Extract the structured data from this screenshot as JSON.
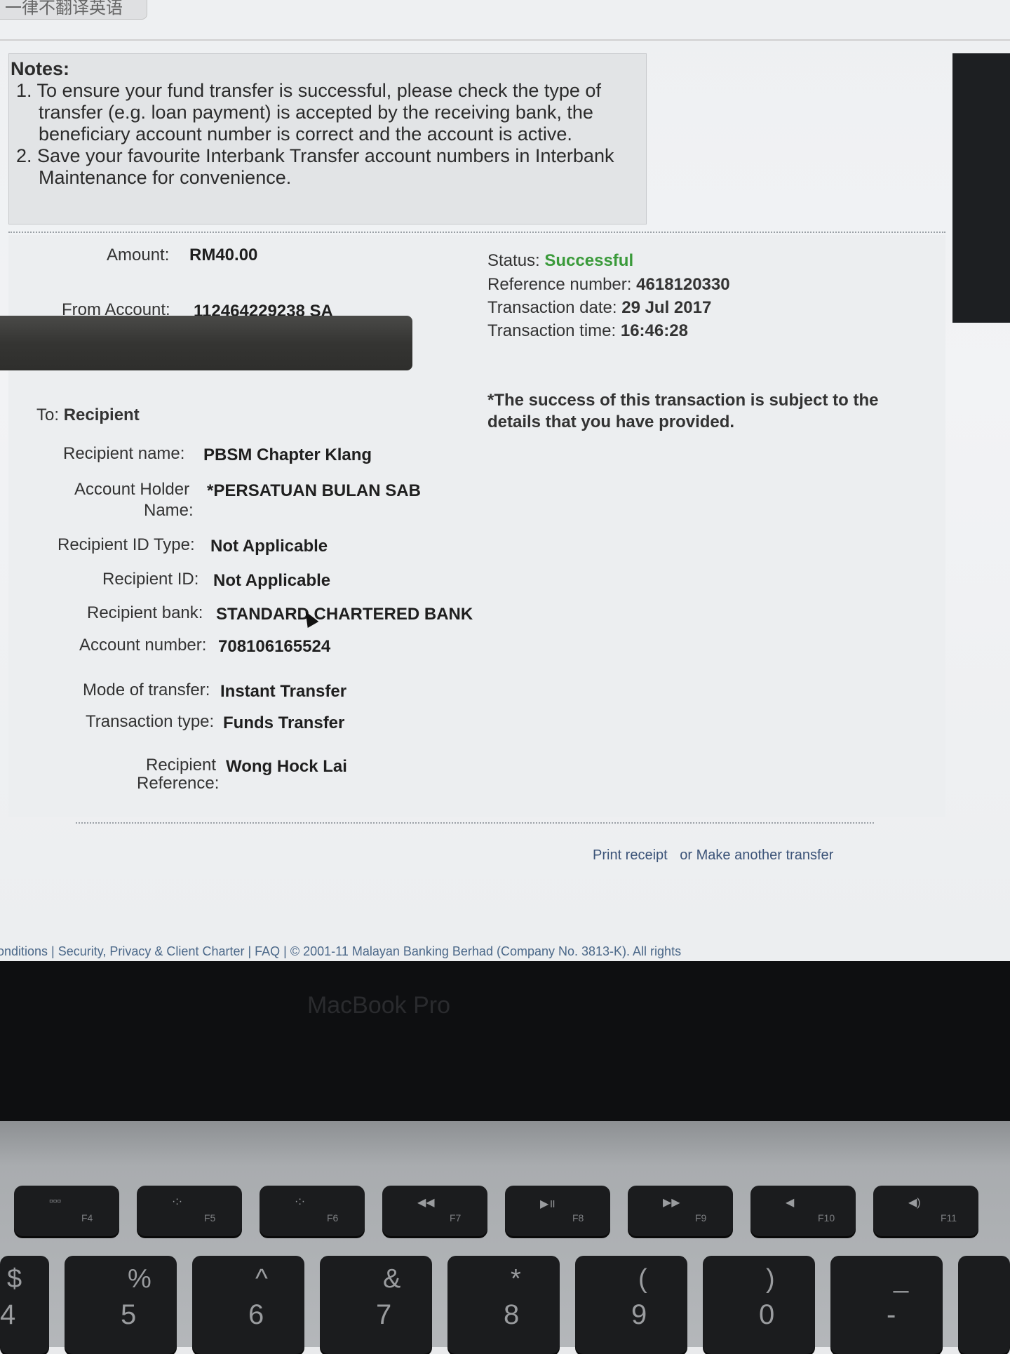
{
  "top_tab": "一律不翻译英语",
  "notes": {
    "title": "Notes:",
    "items": [
      "1. To ensure your fund transfer is successful, please check the type of transfer (e.g. loan payment) is accepted by the receiving bank, the beneficiary account number is correct and the account is active.",
      "2. Save your favourite Interbank Transfer account numbers in Interbank Maintenance for convenience."
    ]
  },
  "transaction": {
    "amount_label": "Amount:",
    "amount_value": "RM40.00",
    "from_label": "From Account:",
    "from_value": "112464229238 SA",
    "status_label": "Status:",
    "status_value": "Successful",
    "status_color": "#3a9a3a",
    "ref_label": "Reference number:",
    "ref_value": "4618120330",
    "date_label": "Transaction date:",
    "date_value": "29 Jul 2017",
    "time_label": "Transaction time:",
    "time_value": "16:46:28",
    "success_note": "*The success of this transaction is subject to the details that you have provided."
  },
  "recipient": {
    "to_label": "To:",
    "to_value": "Recipient",
    "name_label": "Recipient name:",
    "name_value": "PBSM Chapter Klang",
    "holder_label_1": "Account Holder",
    "holder_label_2": "Name:",
    "holder_value": "*PERSATUAN BULAN SAB",
    "idtype_label": "Recipient ID Type:",
    "idtype_value": "Not Applicable",
    "id_label": "Recipient ID:",
    "id_value": "Not Applicable",
    "bank_label": "Recipient bank:",
    "bank_value": "STANDARD CHARTERED BANK",
    "acct_label": "Account number:",
    "acct_value": "708106165524",
    "mode_label": "Mode of transfer:",
    "mode_value": "Instant Transfer",
    "type_label": "Transaction type:",
    "type_value": "Funds Transfer",
    "ref_label_1": "Recipient",
    "ref_label_2": "Reference:",
    "ref_value": "Wong Hock Lai"
  },
  "actions": {
    "print": "Print receipt",
    "or": "or",
    "another": "Make another transfer"
  },
  "footer": "onditions | Security, Privacy & Client Charter | FAQ | © 2001-11 Malayan Banking Berhad (Company No. 3813-K). All rights",
  "laptop": {
    "brand": "MacBook Pro",
    "fkeys": [
      {
        "label": "F4",
        "icon": "launchpad-icon",
        "glyph": "▫▫▫"
      },
      {
        "label": "F5",
        "icon": "keyboard-brightness-down-icon",
        "glyph": "·:·"
      },
      {
        "label": "F6",
        "icon": "keyboard-brightness-up-icon",
        "glyph": "·:·"
      },
      {
        "label": "F7",
        "icon": "rewind-icon",
        "glyph": "◀◀"
      },
      {
        "label": "F8",
        "icon": "play-pause-icon",
        "glyph": "▶॥"
      },
      {
        "label": "F9",
        "icon": "fast-forward-icon",
        "glyph": "▶▶"
      },
      {
        "label": "F10",
        "icon": "mute-icon",
        "glyph": "◀"
      },
      {
        "label": "F11",
        "icon": "volume-icon",
        "glyph": "◀)"
      }
    ],
    "numkeys": [
      {
        "top": "$",
        "bottom": "4"
      },
      {
        "top": "%",
        "bottom": "5"
      },
      {
        "top": "^",
        "bottom": "6"
      },
      {
        "top": "&",
        "bottom": "7"
      },
      {
        "top": "*",
        "bottom": "8"
      },
      {
        "top": "(",
        "bottom": "9"
      },
      {
        "top": ")",
        "bottom": "0"
      },
      {
        "top": "_",
        "bottom": "-"
      },
      {
        "top": "+",
        "bottom": ""
      }
    ]
  }
}
